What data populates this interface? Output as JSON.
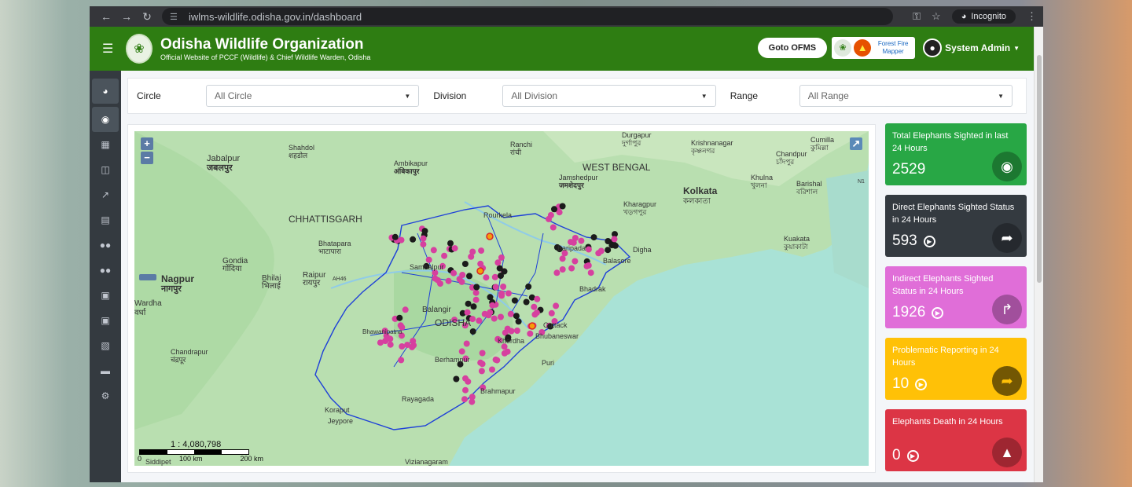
{
  "browser": {
    "url": "iwlms-wildlife.odisha.gov.in/dashboard",
    "incognito_label": "Incognito"
  },
  "header": {
    "title": "Odisha Wildlife Organization",
    "subtitle": "Official Website of PCCF (Wildlife) & Chief Wildlife Warden, Odisha",
    "ofms_button": "Goto OFMS",
    "forest_fire_label": "Forest Fire Mapper",
    "user": "System Admin"
  },
  "sidebar": {
    "icons": [
      "dashboard-icon",
      "elephant-icon",
      "sitemap-icon",
      "map-icon",
      "chart-icon",
      "file-icon",
      "users-icon",
      "users-group-icon",
      "briefcase-icon",
      "briefcase-alt-icon",
      "bold-b-icon",
      "truck-icon",
      "settings-icon"
    ]
  },
  "filters": {
    "circle_label": "Circle",
    "circle_value": "All Circle",
    "division_label": "Division",
    "division_value": "All Division",
    "range_label": "Range",
    "range_value": "All Range"
  },
  "map": {
    "scale_ratio": "1 : 4,080,798",
    "scale_ticks": [
      "0",
      "100 km",
      "200 km"
    ],
    "labels": {
      "jabalpur": "Jabalpur",
      "jabalpur_hi": "जबलपुर",
      "shahdol": "Shahdol",
      "shahdol_hi": "शहडोल",
      "ambikapur": "Ambikapur",
      "ambikapur_hi": "अंबिकापुर",
      "ranchi": "Ranchi",
      "ranchi_hi": "रांची",
      "durgapur": "Durgapur",
      "durgapur_hi": "দুর্গাপুর",
      "krishnanagar": "Krishnanagar",
      "krishnanagar_bn": "কৃষ্ণনগর",
      "cumilla": "Cumilla",
      "cumilla_bn": "কুমিল্লা",
      "chandpur": "Chandpur",
      "chandpur_bn": "চাঁদপুর",
      "jamshedpur": "Jamshedpur",
      "jamshedpur_hi": "जमशेदपुर",
      "west_bengal": "WEST BENGAL",
      "kolkata": "Kolkata",
      "kolkata_bn": "কলকাতা",
      "khulna": "Khulna",
      "khulna_bn": "খুলনা",
      "barishal": "Barishal",
      "barishal_bn": "বরিশাল",
      "kharagpur": "Kharagpur",
      "kharagpur_bn": "খড়গপুর",
      "chhattisgarh": "CHHATTISGARH",
      "rourkela": "Rourkela",
      "bhatapara": "Bhatapara",
      "bhatapara_hi": "भाटापारा",
      "gondia": "Gondia",
      "gondia_hi": "गोंदिया",
      "nagpur": "Nagpur",
      "nagpur_hi": "नागपुर",
      "bhilai": "Bhilai",
      "bhilai_hi": "भिलाई",
      "raipur": "Raipur",
      "raipur_hi": "रायपुर",
      "ah46": "AH46",
      "sambalpur": "Sambalpur",
      "baripada": "Baripada",
      "balasore": "Balasore",
      "digha": "Digha",
      "kuakata": "Kuakata",
      "kuakata_bn": "কুয়াকাটা",
      "bhadrak": "Bhadrak",
      "wardha": "Wardha",
      "wardha_hi": "वर्धा",
      "balangir": "Balangir",
      "odisha": "ODISHA",
      "cuttack": "Cuttack",
      "bhubaneswar": "Bhubaneswar",
      "khordha": "Khordha",
      "bhawanipatna": "Bhawanipatna",
      "berhampur": "Berhampur",
      "puri": "Puri",
      "chandrapur": "Chandrapur",
      "chandrapur_hi": "चंद्रपूर",
      "brahmapur": "Brahmapur",
      "rayagada": "Rayagada",
      "koraput": "Koraput",
      "jeypore": "Jeypore",
      "vizianagaram": "Vizianagaram",
      "siddipet": "Siddipet",
      "n1": "N1"
    }
  },
  "cards": [
    {
      "title": "Total Elephants Sighted in last 24 Hours",
      "value": "2529",
      "icon": "evernote-elephant-icon",
      "color": "#28a745",
      "arrow": false
    },
    {
      "title": "Direct Elephants Sighted Status in 24 Hours",
      "value": "593",
      "icon": "direction-sign-icon",
      "color": "#343a40",
      "arrow": true
    },
    {
      "title": "Indirect Elephants Sighted Status in 24 Hours",
      "value": "1926",
      "icon": "split-arrow-icon",
      "color": "#e06ed8",
      "arrow": true
    },
    {
      "title": "Problematic Reporting in 24 Hours",
      "value": "10",
      "icon": "direction-diamond-icon",
      "color": "#ffc107",
      "arrow": true
    },
    {
      "title": "Elephants Death in 24 Hours",
      "value": "0",
      "icon": "road-icon",
      "color": "#dc3545",
      "arrow": true
    }
  ]
}
